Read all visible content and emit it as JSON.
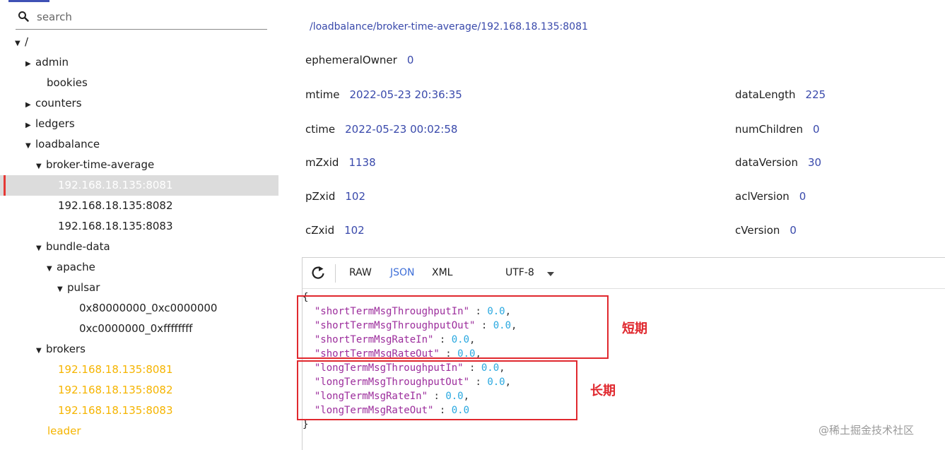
{
  "search": {
    "placeholder": "search"
  },
  "tree": [
    {
      "label": "/",
      "caret": "down",
      "indent": 0
    },
    {
      "label": "admin",
      "caret": "right",
      "indent": 1
    },
    {
      "label": "bookies",
      "caret": "none",
      "indent": 1
    },
    {
      "label": "counters",
      "caret": "right",
      "indent": 1
    },
    {
      "label": "ledgers",
      "caret": "right",
      "indent": 1
    },
    {
      "label": "loadbalance",
      "caret": "down",
      "indent": 1
    },
    {
      "label": "broker-time-average",
      "caret": "down",
      "indent": 2
    },
    {
      "label": "192.168.18.135:8081",
      "caret": "none",
      "indent": 3,
      "state": "selected"
    },
    {
      "label": "192.168.18.135:8082",
      "caret": "none",
      "indent": 3
    },
    {
      "label": "192.168.18.135:8083",
      "caret": "none",
      "indent": 3
    },
    {
      "label": "bundle-data",
      "caret": "down",
      "indent": 2
    },
    {
      "label": "apache",
      "caret": "down",
      "indent": 3
    },
    {
      "label": "pulsar",
      "caret": "down",
      "indent": 4
    },
    {
      "label": "0x80000000_0xc0000000",
      "caret": "none",
      "indent": 5
    },
    {
      "label": "0xc0000000_0xffffffff",
      "caret": "none",
      "indent": 5
    },
    {
      "label": "brokers",
      "caret": "down",
      "indent": 2
    },
    {
      "label": "192.168.18.135:8081",
      "caret": "none",
      "indent": 3,
      "state": "ephemeral"
    },
    {
      "label": "192.168.18.135:8082",
      "caret": "none",
      "indent": 3,
      "state": "ephemeral"
    },
    {
      "label": "192.168.18.135:8083",
      "caret": "none",
      "indent": 3,
      "state": "ephemeral"
    },
    {
      "label": "leader",
      "caret": "none",
      "indent": 2,
      "state": "ephemeral"
    }
  ],
  "node": {
    "path": "/loadbalance/broker-time-average/192.168.18.135:8081",
    "stats_left": [
      {
        "key": "ephemeralOwner",
        "value": "0"
      },
      {
        "key": "mtime",
        "value": "2022-05-23 20:36:35"
      },
      {
        "key": "ctime",
        "value": "2022-05-23 00:02:58"
      },
      {
        "key": "mZxid",
        "value": "1138"
      },
      {
        "key": "pZxid",
        "value": "102"
      },
      {
        "key": "cZxid",
        "value": "102"
      }
    ],
    "stats_right": [
      {
        "key": "dataLength",
        "value": "225"
      },
      {
        "key": "numChildren",
        "value": "0"
      },
      {
        "key": "dataVersion",
        "value": "30"
      },
      {
        "key": "aclVersion",
        "value": "0"
      },
      {
        "key": "cVersion",
        "value": "0"
      }
    ]
  },
  "editor": {
    "formats": [
      "RAW",
      "JSON",
      "XML"
    ],
    "active_format": "JSON",
    "encoding": "UTF-8",
    "open_brace": "{",
    "close_brace": "}",
    "entries": [
      {
        "key": "\"shortTermMsgThroughputIn\"",
        "value": "0.0",
        "comma": ","
      },
      {
        "key": "\"shortTermMsgThroughputOut\"",
        "value": "0.0",
        "comma": ","
      },
      {
        "key": "\"shortTermMsgRateIn\"",
        "value": "0.0",
        "comma": ","
      },
      {
        "key": "\"shortTermMsgRateOut\"",
        "value": "0.0",
        "comma": ","
      },
      {
        "key": "\"longTermMsgThroughputIn\"",
        "value": "0.0",
        "comma": ","
      },
      {
        "key": "\"longTermMsgThroughputOut\"",
        "value": "0.0",
        "comma": ","
      },
      {
        "key": "\"longTermMsgRateIn\"",
        "value": "0.0",
        "comma": ","
      },
      {
        "key": "\"longTermMsgRateOut\"",
        "value": "0.0",
        "comma": ""
      }
    ]
  },
  "annotations": {
    "short_label": "短期",
    "long_label": "长期"
  },
  "watermark": "@稀土掘金技术社区",
  "colors": {
    "accent": "#3f51b5",
    "value_blue": "#3949ab",
    "ephemeral": "#f5b400",
    "annotation_red": "#e0282e"
  }
}
